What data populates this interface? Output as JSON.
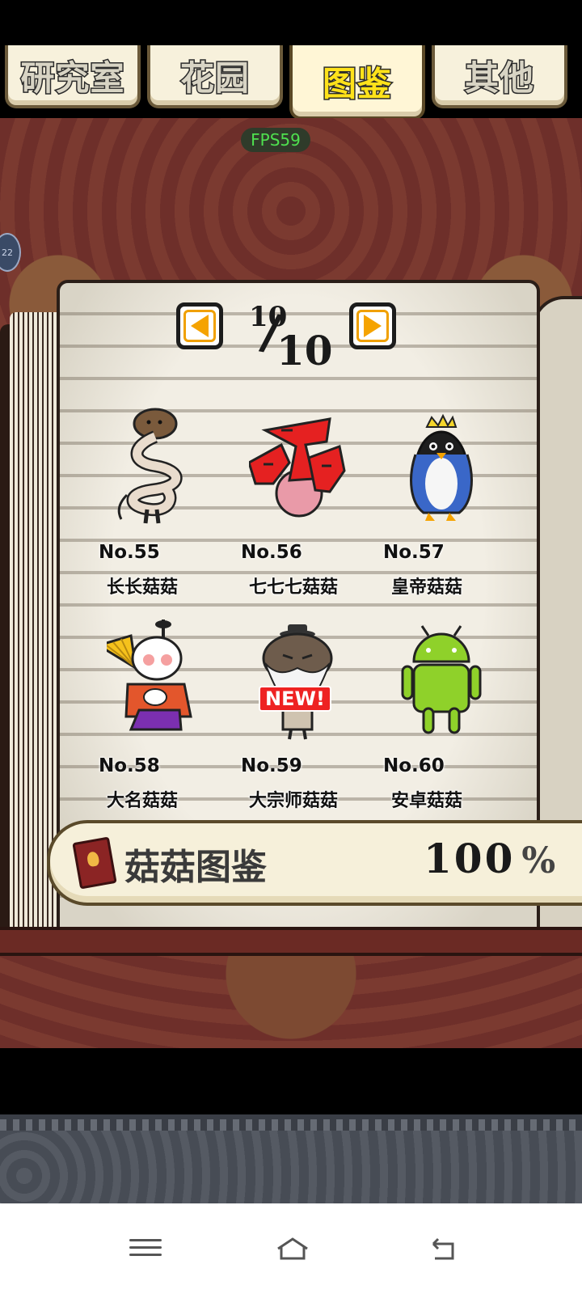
{
  "tabs": [
    {
      "label": "研究室",
      "active": false
    },
    {
      "label": "花园",
      "active": false
    },
    {
      "label": "图鉴",
      "active": true
    },
    {
      "label": "其他",
      "active": false
    }
  ],
  "fps": "FPS59",
  "side_indicator": "22",
  "pager": {
    "current": "10",
    "total": "10"
  },
  "entries": [
    {
      "number": "No.55",
      "name": "长长菇菇",
      "icon": "long-mushroom"
    },
    {
      "number": "No.56",
      "name": "七七七菇菇",
      "icon": "red-777-mushroom"
    },
    {
      "number": "No.57",
      "name": "皇帝菇菇",
      "icon": "emperor-penguin-mushroom"
    },
    {
      "number": "No.58",
      "name": "大名菇菇",
      "icon": "daimyo-mushroom"
    },
    {
      "number": "No.59",
      "name": "大宗师菇菇",
      "icon": "grandmaster-mushroom",
      "badge": "NEW!"
    },
    {
      "number": "No.60",
      "name": "安卓菇菇",
      "icon": "android-mushroom"
    }
  ],
  "banner": {
    "label": "菇菇图鉴",
    "percent": "100",
    "percent_sign": "%"
  },
  "colors": {
    "accent_tab": "#ffe21a",
    "arrow": "#f5a300",
    "fps": "#4fe04f",
    "badge": "#e22222"
  }
}
